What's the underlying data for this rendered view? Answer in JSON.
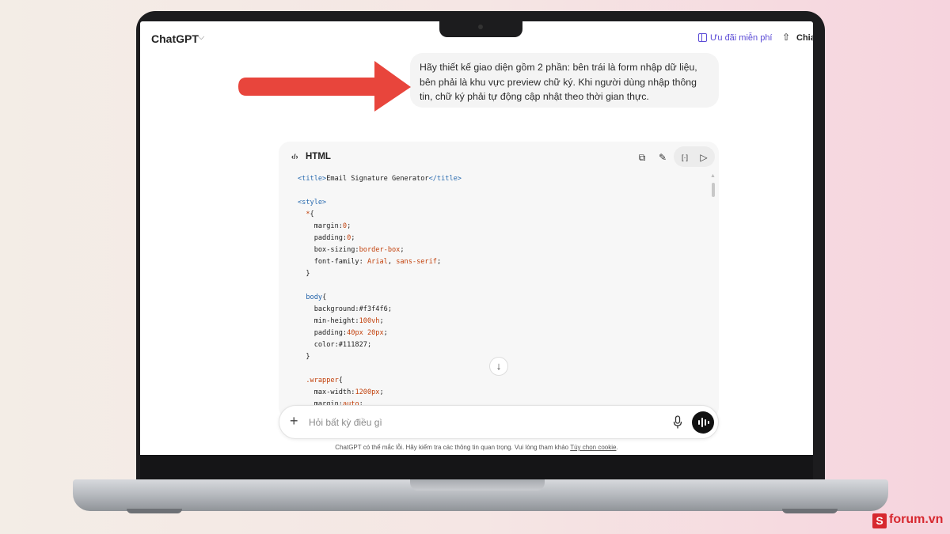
{
  "topbar": {
    "app_name": "ChatGPT",
    "app_chevron": "⌵",
    "promo_label": "Ưu đãi miễn phí",
    "share_icon": "⇧",
    "share_label": "Chia"
  },
  "message": {
    "text": "Hãy thiết kế giao diện gồm 2 phần: bên trái là form nhập dữ liệu, bên phải là khu vực preview chữ ký. Khi người dùng nhập thông tin, chữ ký phải tự động cập nhật theo thời gian thực."
  },
  "code_block": {
    "language_icon": "‹/›",
    "language": "HTML",
    "copy_icon": "⧉",
    "edit_icon": "✎",
    "format_icon": "[·]",
    "run_icon": "▷",
    "jump_icon": "↓",
    "lines": [
      [
        {
          "c": "t",
          "s": "<title>"
        },
        {
          "c": "p",
          "s": "Email Signature Generator"
        },
        {
          "c": "t",
          "s": "</title>"
        }
      ],
      [],
      [
        {
          "c": "t",
          "s": "<style>"
        }
      ],
      [
        {
          "c": "p",
          "s": "  "
        },
        {
          "c": "v",
          "s": "*"
        },
        {
          "c": "p",
          "s": "{"
        }
      ],
      [
        {
          "c": "p",
          "s": "    margin:"
        },
        {
          "c": "v",
          "s": "0"
        },
        {
          "c": "p",
          "s": ";"
        }
      ],
      [
        {
          "c": "p",
          "s": "    padding:"
        },
        {
          "c": "v",
          "s": "0"
        },
        {
          "c": "p",
          "s": ";"
        }
      ],
      [
        {
          "c": "p",
          "s": "    box-sizing:"
        },
        {
          "c": "v",
          "s": "border-box"
        },
        {
          "c": "p",
          "s": ";"
        }
      ],
      [
        {
          "c": "p",
          "s": "    font-family: "
        },
        {
          "c": "v",
          "s": "Arial"
        },
        {
          "c": "p",
          "s": ", "
        },
        {
          "c": "v",
          "s": "sans-serif"
        },
        {
          "c": "p",
          "s": ";"
        }
      ],
      [
        {
          "c": "p",
          "s": "  }"
        }
      ],
      [],
      [
        {
          "c": "p",
          "s": "  "
        },
        {
          "c": "k",
          "s": "body"
        },
        {
          "c": "p",
          "s": "{"
        }
      ],
      [
        {
          "c": "p",
          "s": "    background:#f3f4f6;"
        }
      ],
      [
        {
          "c": "p",
          "s": "    min-height:"
        },
        {
          "c": "v",
          "s": "100vh"
        },
        {
          "c": "p",
          "s": ";"
        }
      ],
      [
        {
          "c": "p",
          "s": "    padding:"
        },
        {
          "c": "v",
          "s": "40px 20px"
        },
        {
          "c": "p",
          "s": ";"
        }
      ],
      [
        {
          "c": "p",
          "s": "    color:#111827;"
        }
      ],
      [
        {
          "c": "p",
          "s": "  }"
        }
      ],
      [],
      [
        {
          "c": "p",
          "s": "  "
        },
        {
          "c": "v",
          "s": ".wrapper"
        },
        {
          "c": "p",
          "s": "{"
        }
      ],
      [
        {
          "c": "p",
          "s": "    max-width:"
        },
        {
          "c": "v",
          "s": "1200px"
        },
        {
          "c": "p",
          "s": ";"
        }
      ],
      [
        {
          "c": "p",
          "s": "    margin:"
        },
        {
          "c": "v",
          "s": "auto"
        },
        {
          "c": "p",
          "s": ";"
        }
      ]
    ]
  },
  "composer": {
    "plus_icon": "+",
    "placeholder": "Hỏi bất kỳ điều gì"
  },
  "footer": {
    "disclaimer": "ChatGPT có thể mắc lỗi. Hãy kiểm tra các thông tin quan trọng. Vui lòng tham khảo ",
    "cookie_link": "Tùy chọn cookie",
    "disclaimer_end": "."
  },
  "watermark": {
    "logo_letter": "S",
    "text": "forum.vn"
  },
  "colors": {
    "accent_purple": "#5b4bd6",
    "arrow_red": "#e8453c",
    "watermark_red": "#d7282f"
  }
}
